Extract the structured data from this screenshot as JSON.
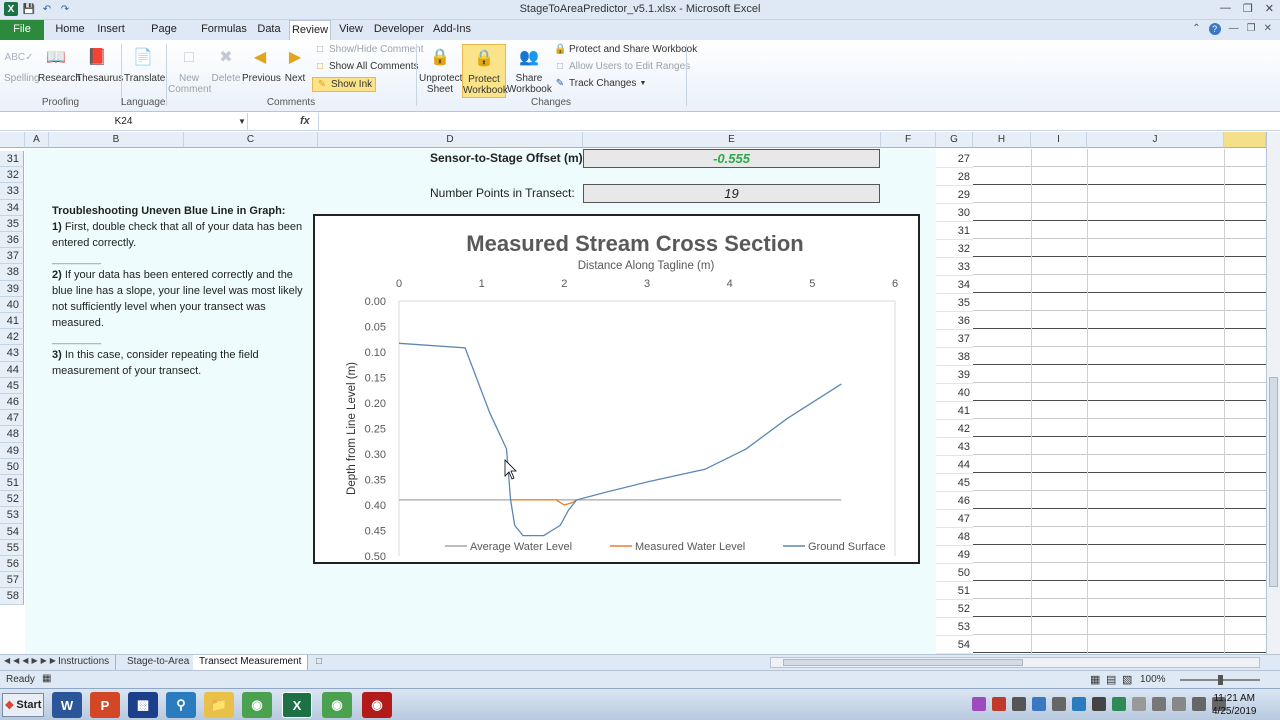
{
  "window": {
    "title": "StageToAreaPredictor_v5.1.xlsx  -  Microsoft Excel",
    "quick_access": [
      "save",
      "undo",
      "redo"
    ]
  },
  "ribbon_tabs": {
    "file": "File",
    "home": "Home",
    "insert": "Insert",
    "page_layout": "Page Layout",
    "formulas": "Formulas",
    "data": "Data",
    "review": "Review",
    "view": "View",
    "developer": "Developer",
    "addins": "Add-Ins"
  },
  "ribbon": {
    "spelling": "Spelling",
    "research": "Research",
    "thesaurus": "Thesaurus",
    "translate": "Translate",
    "new_comment_1": "New",
    "new_comment_2": "Comment",
    "delete": "Delete",
    "previous": "Previous",
    "next": "Next",
    "show_hide_comment": "Show/Hide Comment",
    "show_all_comments": "Show All Comments",
    "show_ink": "Show Ink",
    "unprotect_sheet_1": "Unprotect",
    "unprotect_sheet_2": "Sheet",
    "protect_workbook_1": "Protect",
    "protect_workbook_2": "Workbook",
    "share_workbook_1": "Share",
    "share_workbook_2": "Workbook",
    "protect_share": "Protect and Share Workbook",
    "allow_users": "Allow Users to Edit Ranges",
    "track_changes": "Track Changes",
    "group_proofing": "Proofing",
    "group_language": "Language",
    "group_comments": "Comments",
    "group_changes": "Changes"
  },
  "formula_bar": {
    "name_box": "K24",
    "fx": "fx",
    "content": ""
  },
  "columns": [
    "A",
    "B",
    "C",
    "D",
    "E",
    "F",
    "G",
    "H",
    "I",
    "J"
  ],
  "rows_left": [
    "31",
    "32",
    "33",
    "34",
    "35",
    "36",
    "37",
    "38",
    "39",
    "40",
    "41",
    "42",
    "43",
    "44",
    "45",
    "46",
    "47",
    "48",
    "49",
    "50",
    "51",
    "52",
    "53",
    "54",
    "55",
    "56",
    "57",
    "58"
  ],
  "rows_right": [
    "27",
    "28",
    "29",
    "30",
    "31",
    "32",
    "33",
    "34",
    "35",
    "36",
    "37",
    "38",
    "39",
    "40",
    "41",
    "42",
    "43",
    "44",
    "45",
    "46",
    "47",
    "48",
    "49",
    "50",
    "51",
    "52",
    "53",
    "54"
  ],
  "sheet": {
    "offset_label": "Sensor-to-Stage Offset (m):",
    "offset_value": "-0.555",
    "points_label": "Number Points in Transect:",
    "points_value": "19",
    "trouble_title": "Troubleshooting Uneven Blue Line in Graph:",
    "step1_num": "1)",
    "step1_text": " First, double check that all of your data has been entered correctly.",
    "sep1": "________",
    "step2_num": "2)",
    "step2_text": " If your data has been entered correctly and the blue line has a slope, your line level was most likely not sufficiently level when your transect was measured.",
    "sep2": "________",
    "step3_num": "3)",
    "step3_text": " In this case, consider repeating the field measurement of your transect."
  },
  "chart_data": {
    "type": "line",
    "title": "Measured Stream Cross Section",
    "xlabel": "Distance Along Tagline (m)",
    "ylabel": "Depth from Line Level (m)",
    "xlim": [
      0,
      6
    ],
    "ylim": [
      0,
      0.5
    ],
    "y_inverted": true,
    "x_axis_position": "top",
    "x_ticks": [
      "0",
      "1",
      "2",
      "3",
      "4",
      "5",
      "6"
    ],
    "y_ticks": [
      "0.00",
      "0.05",
      "0.10",
      "0.15",
      "0.20",
      "0.25",
      "0.30",
      "0.35",
      "0.40",
      "0.45",
      "0.50"
    ],
    "grid": false,
    "legend_position": "bottom",
    "series": [
      {
        "name": "Average Water Level",
        "color": "#a5a5a5",
        "x": [
          0,
          5.35
        ],
        "y": [
          0.39,
          0.39
        ]
      },
      {
        "name": "Measured Water Level",
        "color": "#ed7d31",
        "x": [
          1.35,
          1.55,
          1.75,
          1.9,
          2.0,
          2.1,
          2.15
        ],
        "y": [
          0.39,
          0.39,
          0.39,
          0.39,
          0.4,
          0.395,
          0.39
        ]
      },
      {
        "name": "Ground Surface",
        "color": "#5b87b4",
        "x": [
          0,
          0.8,
          1.1,
          1.3,
          1.35,
          1.4,
          1.5,
          1.6,
          1.75,
          1.85,
          1.95,
          2.05,
          2.15,
          2.5,
          3.0,
          3.7,
          4.2,
          4.7,
          5.35
        ],
        "y": [
          0.083,
          0.092,
          0.22,
          0.29,
          0.39,
          0.44,
          0.46,
          0.46,
          0.46,
          0.45,
          0.44,
          0.41,
          0.39,
          0.375,
          0.355,
          0.33,
          0.29,
          0.23,
          0.163
        ]
      }
    ]
  },
  "sheet_tabs": [
    "Instructions",
    "Stage-to-Area",
    "Transect Measurement"
  ],
  "status": {
    "ready": "Ready",
    "zoom": "100%"
  },
  "taskbar": {
    "start": "Start",
    "time": "11:21 AM",
    "date": "4/25/2019"
  }
}
